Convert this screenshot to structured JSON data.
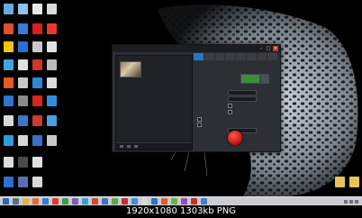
{
  "caption": "1920x1080  1303kb  PNG",
  "window": {
    "title": "",
    "controls": {
      "minimize": "–",
      "maximize": "□",
      "close": "×"
    }
  },
  "tabs": [
    "",
    "",
    "",
    "",
    "",
    "",
    "",
    ""
  ],
  "colors": {
    "accent_tab": "#2476c8",
    "record_button": "#d21c12",
    "taskbar": "#c9cdd1"
  },
  "icons": {
    "desktop": "application-icon",
    "record": "record-icon",
    "thumbnail": "video-thumbnail"
  }
}
